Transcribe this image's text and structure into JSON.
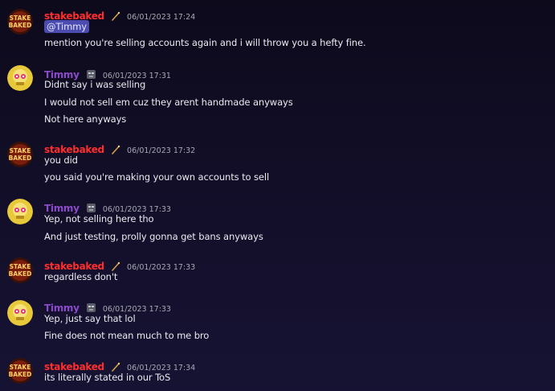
{
  "users": {
    "stakebaked": {
      "name": "stakebaked",
      "color": "#ff2e2e",
      "badge_icon": "bat-icon",
      "avatar_text": [
        "STAKE",
        "BAKED"
      ]
    },
    "timmy": {
      "name": "Timmy",
      "color": "#8a4bc8",
      "badge_icon": "robot-icon"
    }
  },
  "messages": [
    {
      "ts": "06/01/2023 17:24",
      "mention": "@Timmy",
      "lines": [
        "mention you're selling accounts again and i will throw you a hefty fine."
      ]
    },
    {
      "ts": "06/01/2023 17:31",
      "lines": [
        "Didnt say i was selling",
        "I would not sell em cuz they arent handmade anyways",
        "Not here anyways"
      ]
    },
    {
      "ts": "06/01/2023 17:32",
      "lines": [
        "you did",
        "you said you're making your own accounts to sell"
      ]
    },
    {
      "ts": "06/01/2023 17:33",
      "lines": [
        "Yep, not selling here tho",
        "And just testing, prolly gonna get bans anyways"
      ]
    },
    {
      "ts": "06/01/2023 17:33",
      "lines": [
        "regardless don't"
      ]
    },
    {
      "ts": "06/01/2023 17:33",
      "lines": [
        "Yep, just say that lol",
        "Fine does not mean much to me bro"
      ]
    },
    {
      "ts": "06/01/2023 17:34",
      "lines": [
        "its literally stated in our ToS"
      ]
    }
  ]
}
